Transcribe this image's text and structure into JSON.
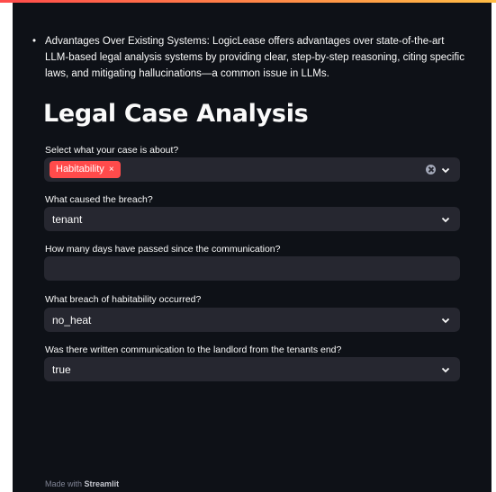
{
  "intro": {
    "bullet_text": "Advantages Over Existing Systems: LogicLease offers advantages over state-of-the-art LLM-based legal analysis systems by providing clear, step-by-step reasoning, citing specific laws, and mitigating hallucinations—a common issue in LLMs."
  },
  "title": "Legal Case Analysis",
  "fields": {
    "case_about": {
      "label": "Select what your case is about?",
      "chip": "Habitability",
      "chip_remove": "×"
    },
    "breach_cause": {
      "label": "What caused the breach?",
      "value": "tenant"
    },
    "days_passed": {
      "label": "How many days have passed since the communication?",
      "value": ""
    },
    "breach_type": {
      "label": "What breach of habitability occurred?",
      "value": "no_heat"
    },
    "written_comm": {
      "label": "Was there written communication to the landlord from the tenants end?",
      "value": "true"
    }
  },
  "footer": {
    "prefix": "Made with",
    "brand": "Streamlit"
  },
  "colors": {
    "accent": "#ff4b4b",
    "background": "#0e1117",
    "widget": "#262730"
  },
  "icons": {
    "dropdown": "chevron-down-icon",
    "clear": "clear-icon",
    "chip_remove": "close-icon"
  }
}
